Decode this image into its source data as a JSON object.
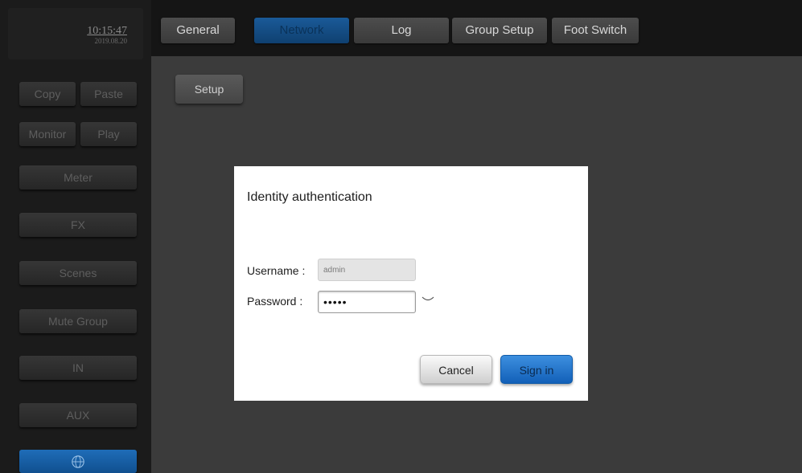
{
  "clock": {
    "time": "10:15:47",
    "date": "2019.08.20"
  },
  "sidebar": {
    "copy": "Copy",
    "paste": "Paste",
    "monitor": "Monitor",
    "play": "Play",
    "meter": "Meter",
    "fx": "FX",
    "scenes": "Scenes",
    "mute_group": "Mute Group",
    "in": "IN",
    "aux": "AUX",
    "bottom_icon": "globe-icon"
  },
  "tabs": [
    {
      "label": "General",
      "active": false
    },
    {
      "label": "Network",
      "active": true
    },
    {
      "label": "Log",
      "active": false
    },
    {
      "label": "Group Setup",
      "active": false
    },
    {
      "label": "Foot Switch",
      "active": false
    }
  ],
  "subnav": {
    "setup": "Setup"
  },
  "dialog": {
    "title": "Identity authentication",
    "username_label": "Username :",
    "username_value": "admin",
    "password_label": "Password :",
    "password_value": "•••••",
    "password_toggle_icon": "eye-closed-icon",
    "cancel_label": "Cancel",
    "signin_label": "Sign in"
  },
  "colors": {
    "accent_blue": "#1a5a98",
    "background": "#3b3b3b",
    "sidebar": "#1b1b1b"
  }
}
